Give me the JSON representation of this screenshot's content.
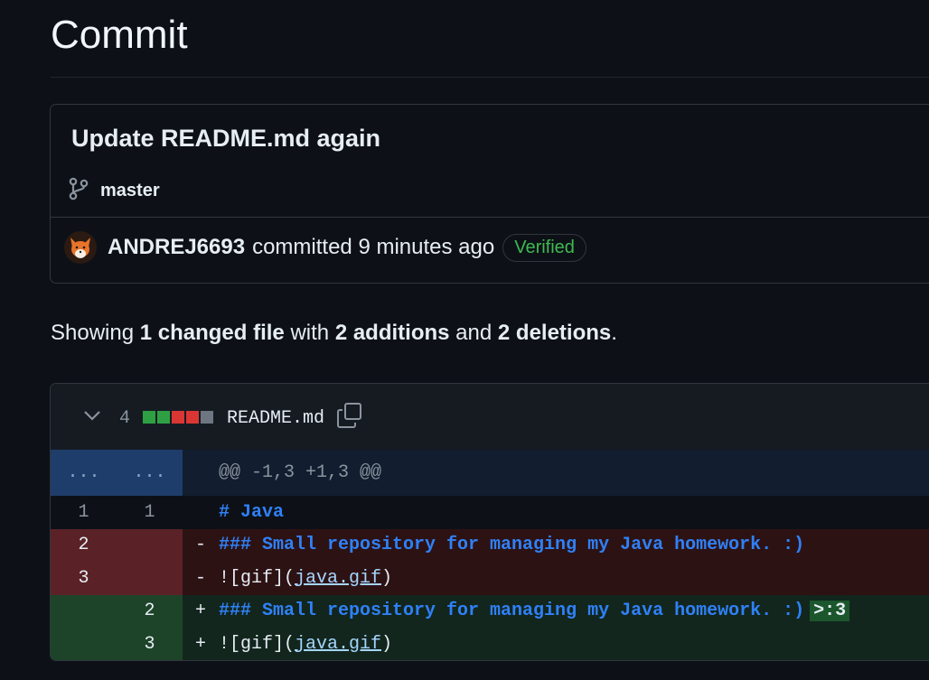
{
  "page": {
    "title": "Commit"
  },
  "commit": {
    "message": "Update README.md again",
    "branch": "master",
    "author": "ANDREJ6693",
    "action_text": "committed 9 minutes ago",
    "verified_label": "Verified"
  },
  "summary": {
    "prefix": "Showing",
    "files": "1 changed file",
    "with": "with",
    "additions": "2 additions",
    "and": "and",
    "deletions": "2 deletions",
    "suffix": "."
  },
  "diff": {
    "change_count": "4",
    "diffstat_colors": [
      "#2ea043",
      "#2ea043",
      "#da3633",
      "#da3633",
      "#6e7681"
    ],
    "file_name": "README.md",
    "hunk": {
      "old": "...",
      "new": "...",
      "header": "@@ -1,3 +1,3 @@"
    },
    "lines": [
      {
        "old": "1",
        "new": "1",
        "sign": "",
        "code": "# Java"
      },
      {
        "old": "2",
        "new": "",
        "sign": "-",
        "code": "### Small repository for managing my Java homework. :)"
      },
      {
        "old": "3",
        "new": "",
        "sign": "-",
        "code_prefix": "![gif](",
        "code_link": "java.gif",
        "code_suffix": ")"
      },
      {
        "old": "",
        "new": "2",
        "sign": "+",
        "code": "### Small repository for managing my Java homework. :)",
        "code_added": ">:3"
      },
      {
        "old": "",
        "new": "3",
        "sign": "+",
        "code_prefix": "![gif](",
        "code_link": "java.gif",
        "code_suffix": ")"
      }
    ]
  }
}
